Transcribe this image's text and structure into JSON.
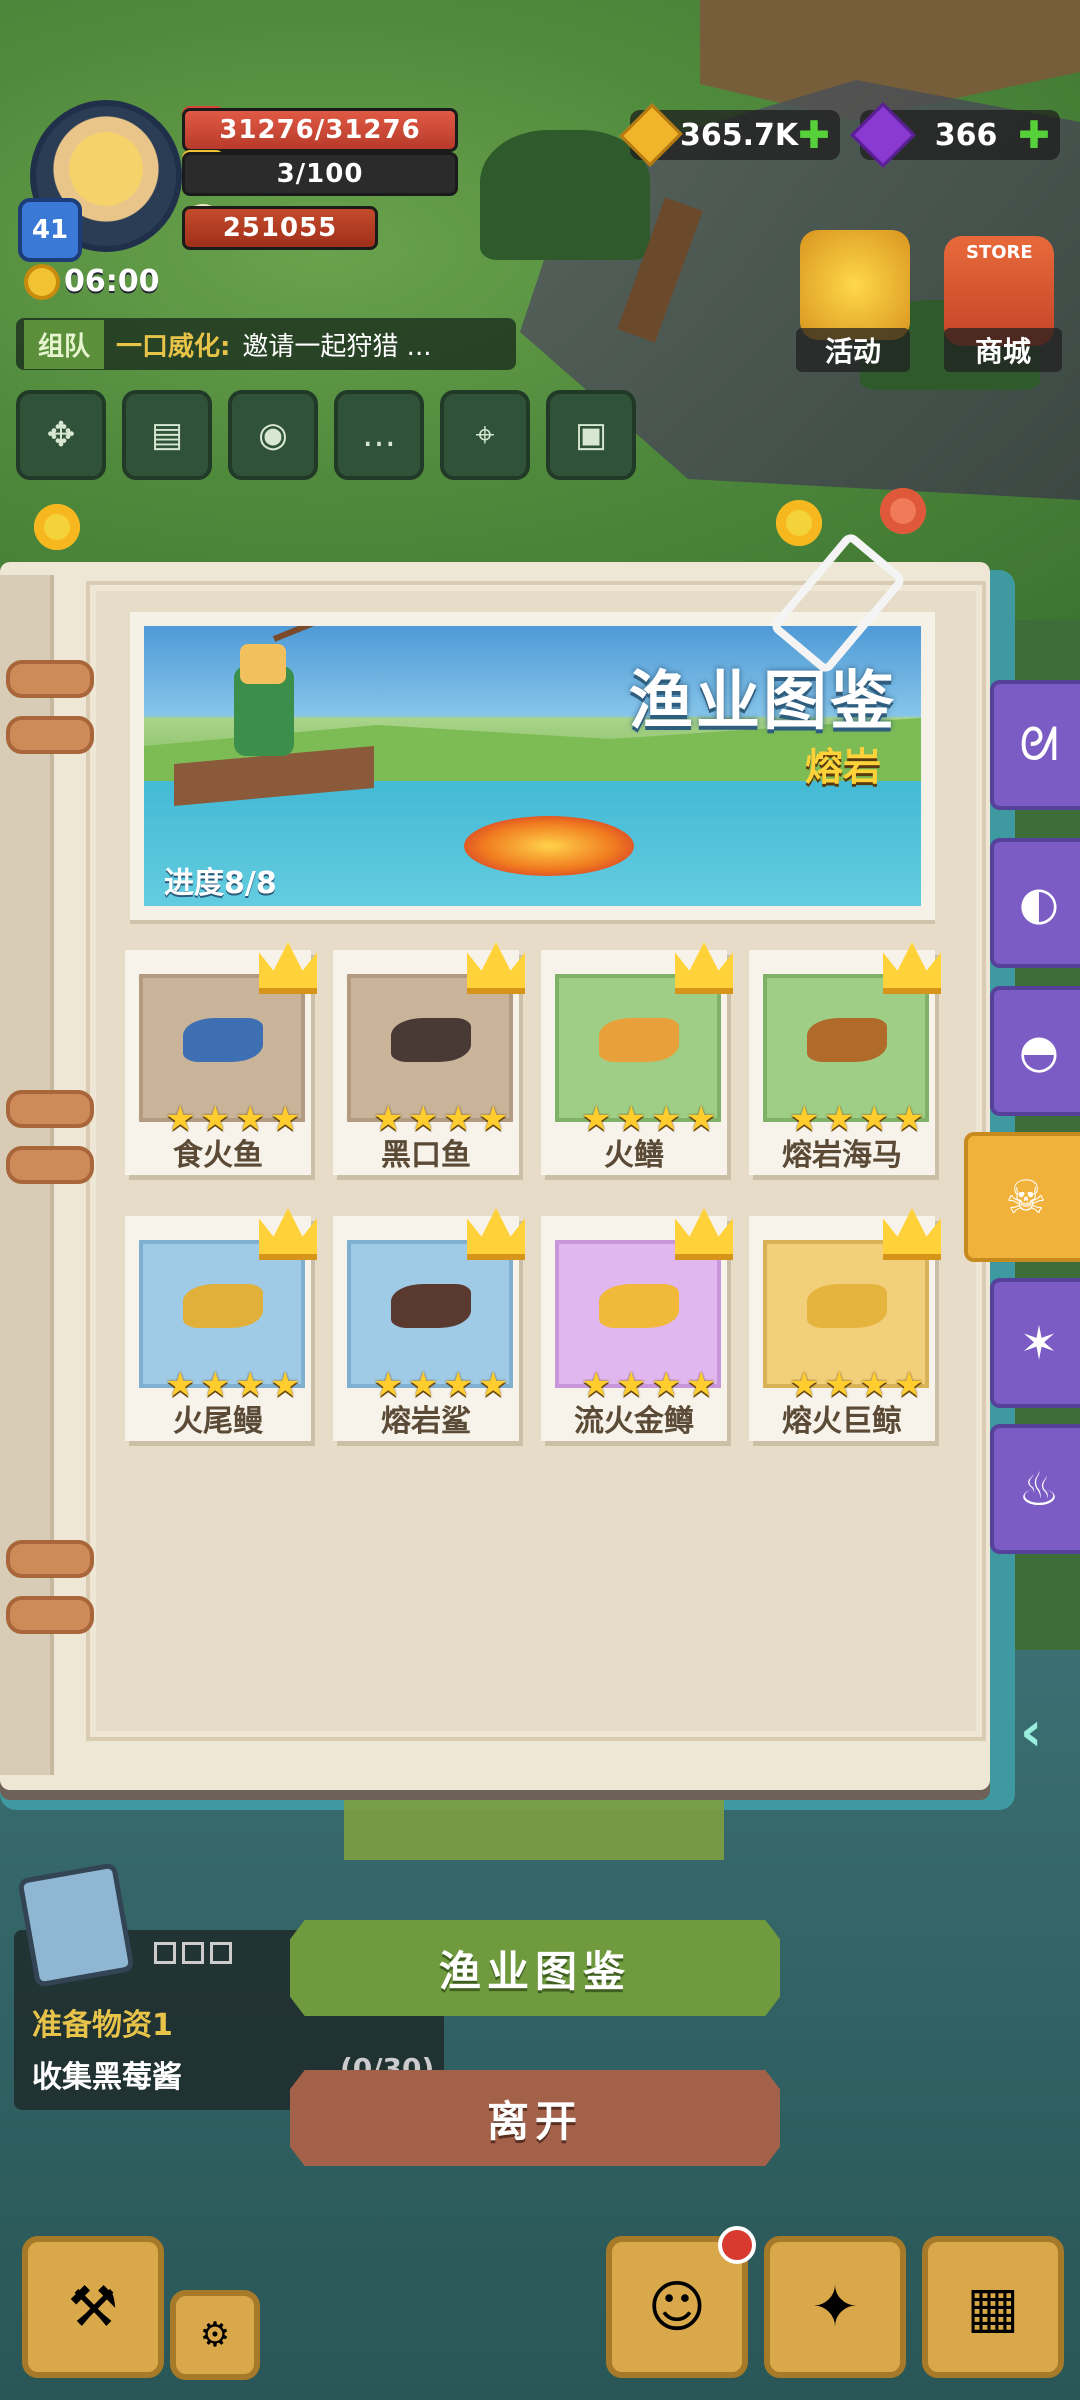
{
  "hud": {
    "level": "41",
    "hp": "31276/31276",
    "energy": "3/100",
    "coins": "251055",
    "time": "06:00",
    "gold": "365.7K",
    "gems": "366",
    "chat": {
      "channel": "组队",
      "speaker": "一口威化:",
      "message": "邀请一起狩猎 ..."
    },
    "quick_icons": [
      "grid-icon",
      "map-chat-icon",
      "pet-icon",
      "chat-icon",
      "map-icon",
      "clipboard-icon"
    ],
    "event_label": "活动",
    "shop_label": "商城",
    "shop_sign": "STORE"
  },
  "book": {
    "banner_title": "渔业图鉴",
    "banner_subtitle": "熔岩",
    "progress": "进度8/8",
    "fish": [
      {
        "name": "食火鱼",
        "frame": "brown",
        "color": "#3f6fb3"
      },
      {
        "name": "黑口鱼",
        "frame": "brown",
        "color": "#4a3a36"
      },
      {
        "name": "火鳝",
        "frame": "green",
        "color": "#e8a13a"
      },
      {
        "name": "熔岩海马",
        "frame": "green",
        "color": "#b06a2a"
      },
      {
        "name": "火尾鳗",
        "frame": "blue",
        "color": "#e0b03a"
      },
      {
        "name": "熔岩鲨",
        "frame": "blue",
        "color": "#5a3a30"
      },
      {
        "name": "流火金鳟",
        "frame": "purple",
        "color": "#f0b93a"
      },
      {
        "name": "熔火巨鲸",
        "frame": "gold",
        "color": "#e4b43e"
      }
    ],
    "star_char": "★",
    "side_tabs": [
      "fish-icon",
      "shell-icon",
      "scallop-icon",
      "octopus-icon",
      "starfish-icon",
      "flame-icon"
    ],
    "active_tab": 3
  },
  "bottom": {
    "quest_title": "准备物资1",
    "quest_desc": "收集黑莓酱",
    "quest_count": "(0/30)",
    "guide_button": "渔业图鉴",
    "leave_button": "离开"
  }
}
